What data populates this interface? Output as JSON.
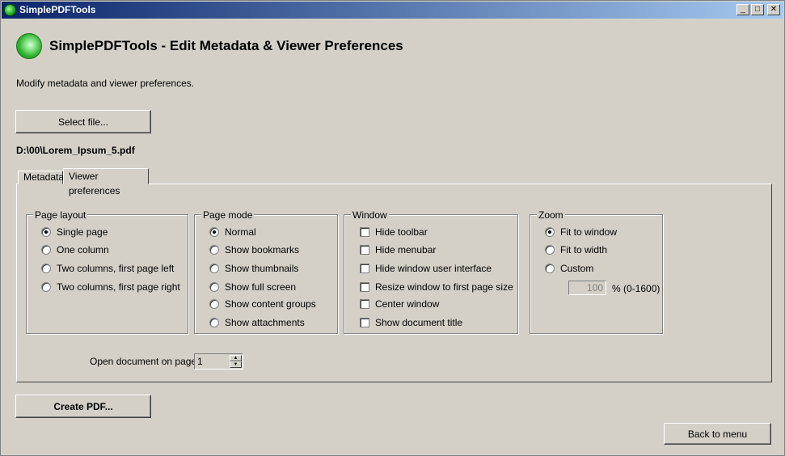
{
  "window": {
    "title": "SimplePDFTools",
    "minimize": "_",
    "maximize": "□",
    "close": "✕"
  },
  "header": {
    "title": "SimplePDFTools - Edit Metadata & Viewer Preferences",
    "description": "Modify metadata and viewer preferences."
  },
  "file": {
    "select_label": "Select file...",
    "path": "D:\\00\\Lorem_Ipsum_5.pdf"
  },
  "tabs": [
    {
      "label": "Metadata",
      "active": false
    },
    {
      "label": "Viewer preferences",
      "active": true
    }
  ],
  "page_layout": {
    "legend": "Page layout",
    "options": [
      {
        "label": "Single page",
        "checked": true
      },
      {
        "label": "One column",
        "checked": false
      },
      {
        "label": "Two columns, first page left",
        "checked": false
      },
      {
        "label": "Two columns, first page right",
        "checked": false
      }
    ]
  },
  "page_mode": {
    "legend": "Page mode",
    "options": [
      {
        "label": "Normal",
        "checked": true
      },
      {
        "label": "Show bookmarks",
        "checked": false
      },
      {
        "label": "Show thumbnails",
        "checked": false
      },
      {
        "label": "Show full screen",
        "checked": false
      },
      {
        "label": "Show content groups",
        "checked": false
      },
      {
        "label": "Show attachments",
        "checked": false
      }
    ]
  },
  "window_prefs": {
    "legend": "Window",
    "options": [
      {
        "label": "Hide toolbar",
        "checked": false
      },
      {
        "label": "Hide menubar",
        "checked": false
      },
      {
        "label": "Hide window user interface",
        "checked": false
      },
      {
        "label": "Resize window to first page size",
        "checked": false
      },
      {
        "label": "Center window",
        "checked": false
      },
      {
        "label": "Show document title",
        "checked": false
      }
    ]
  },
  "zoom": {
    "legend": "Zoom",
    "options": [
      {
        "label": "Fit to window",
        "checked": true
      },
      {
        "label": "Fit to width",
        "checked": false
      },
      {
        "label": "Custom",
        "checked": false
      }
    ],
    "custom_value": "100",
    "unit_label": "% (0-1600)"
  },
  "open_page": {
    "label": "Open document on page",
    "value": "1"
  },
  "actions": {
    "create_label": "Create PDF...",
    "back_label": "Back to menu"
  }
}
